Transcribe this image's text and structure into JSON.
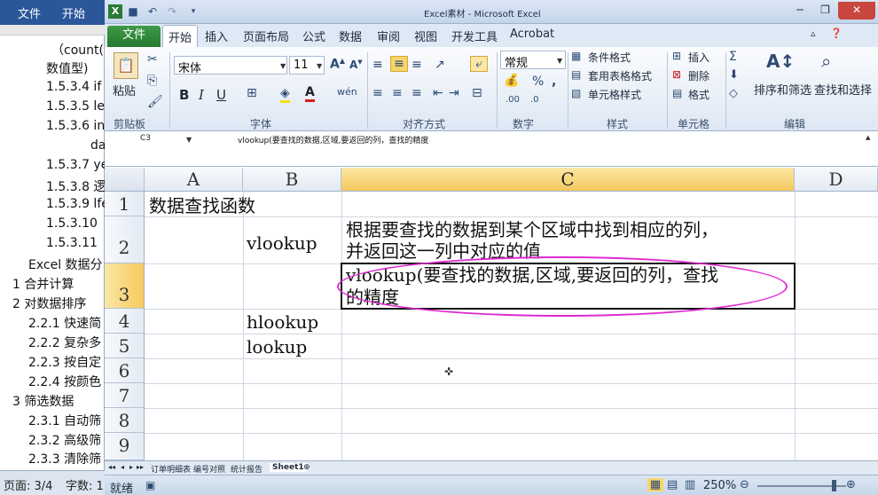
{
  "word_doc": {
    "tabs": [
      "文件",
      "开始"
    ],
    "lines": [
      "（count(",
      "数值型)",
      "1.5.3.4 if",
      "1.5.3.5 le",
      "1.5.3.6 in",
      "da",
      "1.5.3.7 ye",
      "1.5.3.8 逻",
      "1.5.3.9 lfe",
      "1.5.3.10",
      "1.5.3.11",
      "Excel 数据分",
      "1   合并计算",
      "2   对数据排序",
      "2.2.1 快速简",
      "2.2.2 复杂多",
      "2.2.3 按自定",
      "2.2.4 按颜色",
      "3   筛选数据",
      "2.3.1 自动筛",
      "2.3.2 高级筛",
      "2.3.3 清除筛"
    ],
    "status_page": "页面: 3/4",
    "status_words": "字数: 1"
  },
  "titlebar": {
    "title": "Excel素材 - Microsoft Excel"
  },
  "ribbon_tabs": [
    "文件",
    "开始",
    "插入",
    "页面布局",
    "公式",
    "数据",
    "审阅",
    "视图",
    "开发工具",
    "Acrobat"
  ],
  "ribbon": {
    "paste": "粘贴",
    "font_name": "宋体",
    "font_size": "11",
    "bold": "B",
    "italic": "I",
    "underline": "U",
    "number_format": "常规",
    "conditional_format": "条件格式",
    "table_format": "套用表格格式",
    "cell_style": "单元格样式",
    "insert": "插入",
    "delete": "删除",
    "format": "格式",
    "sort_filter": "排序和筛选",
    "find_select": "查找和选择",
    "groups": [
      "剪贴板",
      "字体",
      "对齐方式",
      "数字",
      "样式",
      "单元格",
      "编辑"
    ]
  },
  "formula_bar": {
    "name_box": "C3",
    "content": "vlookup(要查找的数据,区域,要返回的列，查找的精度"
  },
  "columns": [
    "A",
    "B",
    "C",
    "D"
  ],
  "rows": [
    "1",
    "2",
    "3",
    "4",
    "5",
    "6",
    "7",
    "8",
    "9"
  ],
  "cells": {
    "A1": "数据查找函数",
    "B2": "vlookup",
    "C2_line1": "根据要查找的数据到某个区域中找到相应的列，",
    "C2_line2": "并返回这一列中对应的值",
    "C3_line1": "vlookup(要查找的数据,区域,要返回的列，查找",
    "C3_line2": "的精度",
    "B4": "hlookup",
    "B5": "lookup"
  },
  "sheet_tabs": [
    "订单明细表",
    "编号对照",
    "统计报告",
    "Sheet1"
  ],
  "status": {
    "mode": "就绪",
    "zoom": "250%"
  }
}
